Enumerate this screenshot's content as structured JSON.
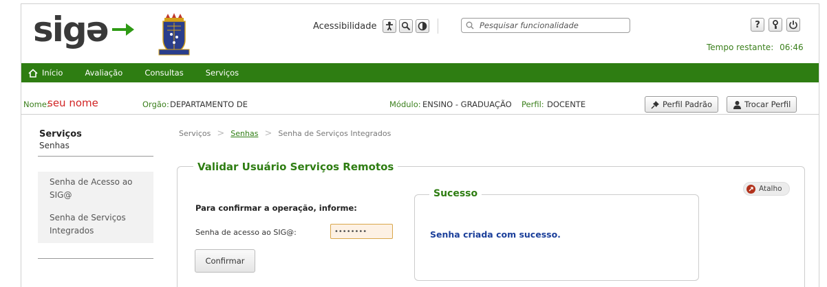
{
  "header": {
    "logo_text": "sigə",
    "accessibility_label": "Acessibilidade",
    "search_placeholder": "Pesquisar funcionalidade",
    "timer_label": "Tempo restante:",
    "timer_value": "06:46",
    "icons": [
      "accessibility-person-icon",
      "magnifier-person-icon",
      "contrast-icon",
      "help-icon",
      "key-icon",
      "power-icon"
    ]
  },
  "nav": {
    "items": [
      {
        "label": "Início",
        "icon": "home-icon"
      },
      {
        "label": "Avaliação"
      },
      {
        "label": "Consultas"
      },
      {
        "label": "Serviços"
      }
    ]
  },
  "infobar": {
    "nome_label": "Nome:",
    "nome_value": "seu nome",
    "orgao_label": "Orgão:",
    "orgao_value": "DEPARTAMENTO DE",
    "modulo_label": "Módulo:",
    "modulo_value": "ENSINO - GRADUAÇÃO",
    "perfil_label": "Perfil:",
    "perfil_value": "DOCENTE",
    "perfil_padrao_button": "Perfil Padrão",
    "trocar_perfil_button": "Trocar Perfil"
  },
  "sidebar": {
    "title": "Serviços",
    "subtitle": "Senhas",
    "items": [
      {
        "label": "Senha de Acesso ao SIG@"
      },
      {
        "label": "Senha de Serviços Integrados"
      }
    ]
  },
  "breadcrumb": {
    "items": [
      "Serviços",
      "Senhas",
      "Senha de Serviços Integrados"
    ]
  },
  "main": {
    "panel_title": "Validar Usuário Serviços Remotos",
    "confirm_title": "Para confirmar a operação, informe:",
    "password_label": "Senha de acesso ao SIG@:",
    "password_value": "••••••••",
    "confirm_button": "Confirmar",
    "atalho_label": "Atalho"
  },
  "success": {
    "title": "Sucesso",
    "message": "Senha criada com sucesso."
  },
  "colors": {
    "brand_green": "#2e7d12",
    "success_text": "#1b3f9a",
    "name_red": "#d12222"
  }
}
